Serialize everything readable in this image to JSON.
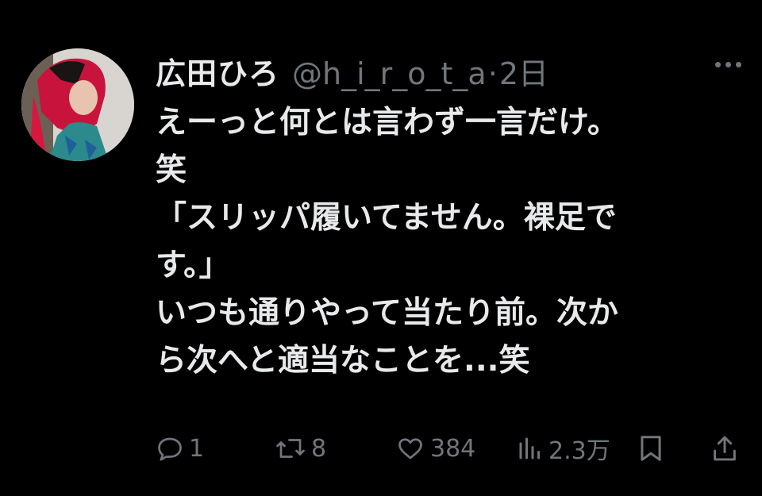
{
  "tweet": {
    "display_name": "広田ひろ",
    "handle": "@h_i_r_o_t_a",
    "separator": "·",
    "time": "2日",
    "more_icon": "ellipsis-icon",
    "body_lines": [
      "えーっと何とは言わず一言だけ。",
      "笑",
      "「スリッパ履いてません。裸足で",
      "す。」",
      "いつも通りやって当たり前。次か",
      "ら次へと適当なことを...笑"
    ],
    "actions": {
      "reply": {
        "icon": "reply-icon",
        "count": "1"
      },
      "retweet": {
        "icon": "retweet-icon",
        "count": "8"
      },
      "like": {
        "icon": "heart-icon",
        "count": "384"
      },
      "views": {
        "icon": "views-icon",
        "count": "2.3万"
      },
      "bookmark": {
        "icon": "bookmark-icon"
      },
      "share": {
        "icon": "share-icon"
      }
    }
  },
  "colors": {
    "background": "#000000",
    "primary_text": "#e7e9ea",
    "secondary_text": "#71767b"
  }
}
